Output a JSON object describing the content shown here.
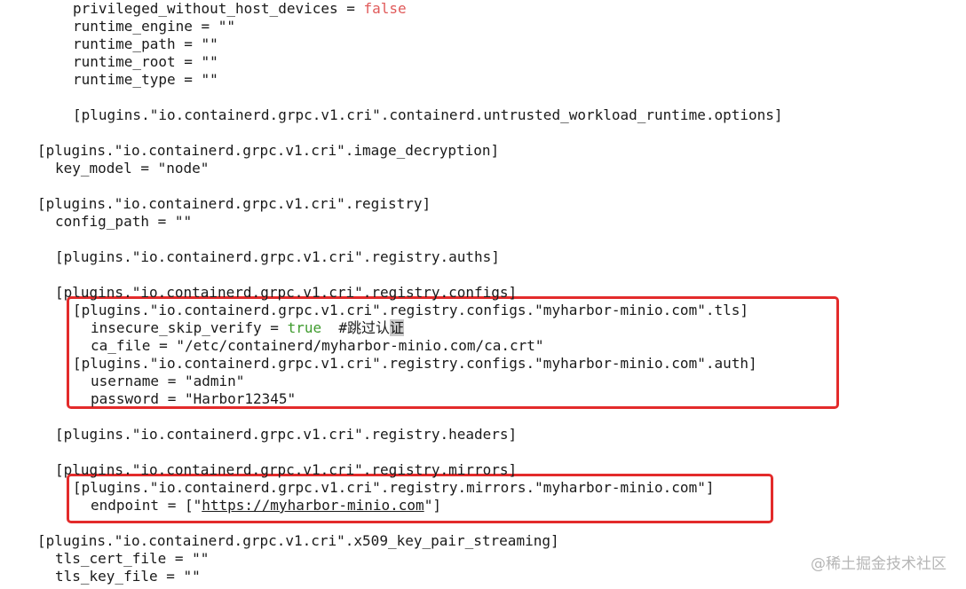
{
  "config_lines": [
    {
      "indent": 4,
      "tokens": [
        {
          "t": "privileged_without_host_devices = "
        },
        {
          "t": "false",
          "kind": "false"
        }
      ]
    },
    {
      "indent": 4,
      "tokens": [
        {
          "t": "runtime_engine = \"\""
        }
      ]
    },
    {
      "indent": 4,
      "tokens": [
        {
          "t": "runtime_path = \"\""
        }
      ]
    },
    {
      "indent": 4,
      "tokens": [
        {
          "t": "runtime_root = \"\""
        }
      ]
    },
    {
      "indent": 4,
      "tokens": [
        {
          "t": "runtime_type = \"\""
        }
      ]
    },
    {
      "indent": 0,
      "tokens": []
    },
    {
      "indent": 4,
      "tokens": [
        {
          "t": "[plugins.\"io.containerd.grpc.v1.cri\".containerd.untrusted_workload_runtime.options]"
        }
      ]
    },
    {
      "indent": 0,
      "tokens": []
    },
    {
      "indent": 0,
      "tokens": [
        {
          "t": "[plugins.\"io.containerd.grpc.v1.cri\".image_decryption]"
        }
      ]
    },
    {
      "indent": 2,
      "tokens": [
        {
          "t": "key_model = \"node\""
        }
      ]
    },
    {
      "indent": 0,
      "tokens": []
    },
    {
      "indent": 0,
      "tokens": [
        {
          "t": "[plugins.\"io.containerd.grpc.v1.cri\".registry]"
        }
      ]
    },
    {
      "indent": 2,
      "tokens": [
        {
          "t": "config_path = \"\""
        }
      ]
    },
    {
      "indent": 0,
      "tokens": []
    },
    {
      "indent": 2,
      "tokens": [
        {
          "t": "[plugins.\"io.containerd.grpc.v1.cri\".registry.auths]"
        }
      ]
    },
    {
      "indent": 0,
      "tokens": []
    },
    {
      "indent": 2,
      "tokens": [
        {
          "t": "[plugins.\"io.containerd.grpc.v1.cri\".registry.configs]"
        }
      ]
    },
    {
      "indent": 4,
      "tokens": [
        {
          "t": "[plugins.\"io.containerd.grpc.v1.cri\".registry.configs.\"myharbor-minio.com\".tls]"
        }
      ]
    },
    {
      "indent": 6,
      "tokens": [
        {
          "t": "insecure_skip_verify = "
        },
        {
          "t": "true",
          "kind": "true"
        },
        {
          "t": "  #跳过认"
        },
        {
          "t": "证",
          "kind": "cursor"
        }
      ]
    },
    {
      "indent": 6,
      "tokens": [
        {
          "t": "ca_file = \"/etc/containerd/myharbor-minio.com/ca.crt\""
        }
      ]
    },
    {
      "indent": 4,
      "tokens": [
        {
          "t": "[plugins.\"io.containerd.grpc.v1.cri\".registry.configs.\"myharbor-minio.com\".auth]"
        }
      ]
    },
    {
      "indent": 6,
      "tokens": [
        {
          "t": "username = \"admin\""
        }
      ]
    },
    {
      "indent": 6,
      "tokens": [
        {
          "t": "password = \"Harbor12345\""
        }
      ]
    },
    {
      "indent": 0,
      "tokens": []
    },
    {
      "indent": 2,
      "tokens": [
        {
          "t": "[plugins.\"io.containerd.grpc.v1.cri\".registry.headers]"
        }
      ]
    },
    {
      "indent": 0,
      "tokens": []
    },
    {
      "indent": 2,
      "tokens": [
        {
          "t": "[plugins.\"io.containerd.grpc.v1.cri\".registry.mirrors]"
        }
      ]
    },
    {
      "indent": 4,
      "tokens": [
        {
          "t": "[plugins.\"io.containerd.grpc.v1.cri\".registry.mirrors.\"myharbor-minio.com\"]"
        }
      ]
    },
    {
      "indent": 6,
      "tokens": [
        {
          "t": "endpoint = [\""
        },
        {
          "t": "https://myharbor-minio.com",
          "kind": "url"
        },
        {
          "t": "\"]"
        }
      ]
    },
    {
      "indent": 0,
      "tokens": []
    },
    {
      "indent": 0,
      "tokens": [
        {
          "t": "[plugins.\"io.containerd.grpc.v1.cri\".x509_key_pair_streaming]"
        }
      ]
    },
    {
      "indent": 2,
      "tokens": [
        {
          "t": "tls_cert_file = \"\""
        }
      ]
    },
    {
      "indent": 2,
      "tokens": [
        {
          "t": "tls_key_file = \"\""
        }
      ]
    }
  ],
  "highlight_color": "#e32b2b",
  "keyword_colors": {
    "false": "#e05a5a",
    "true": "#3f9b2e"
  },
  "watermark": {
    "text": "@稀土掘金技术社区"
  }
}
